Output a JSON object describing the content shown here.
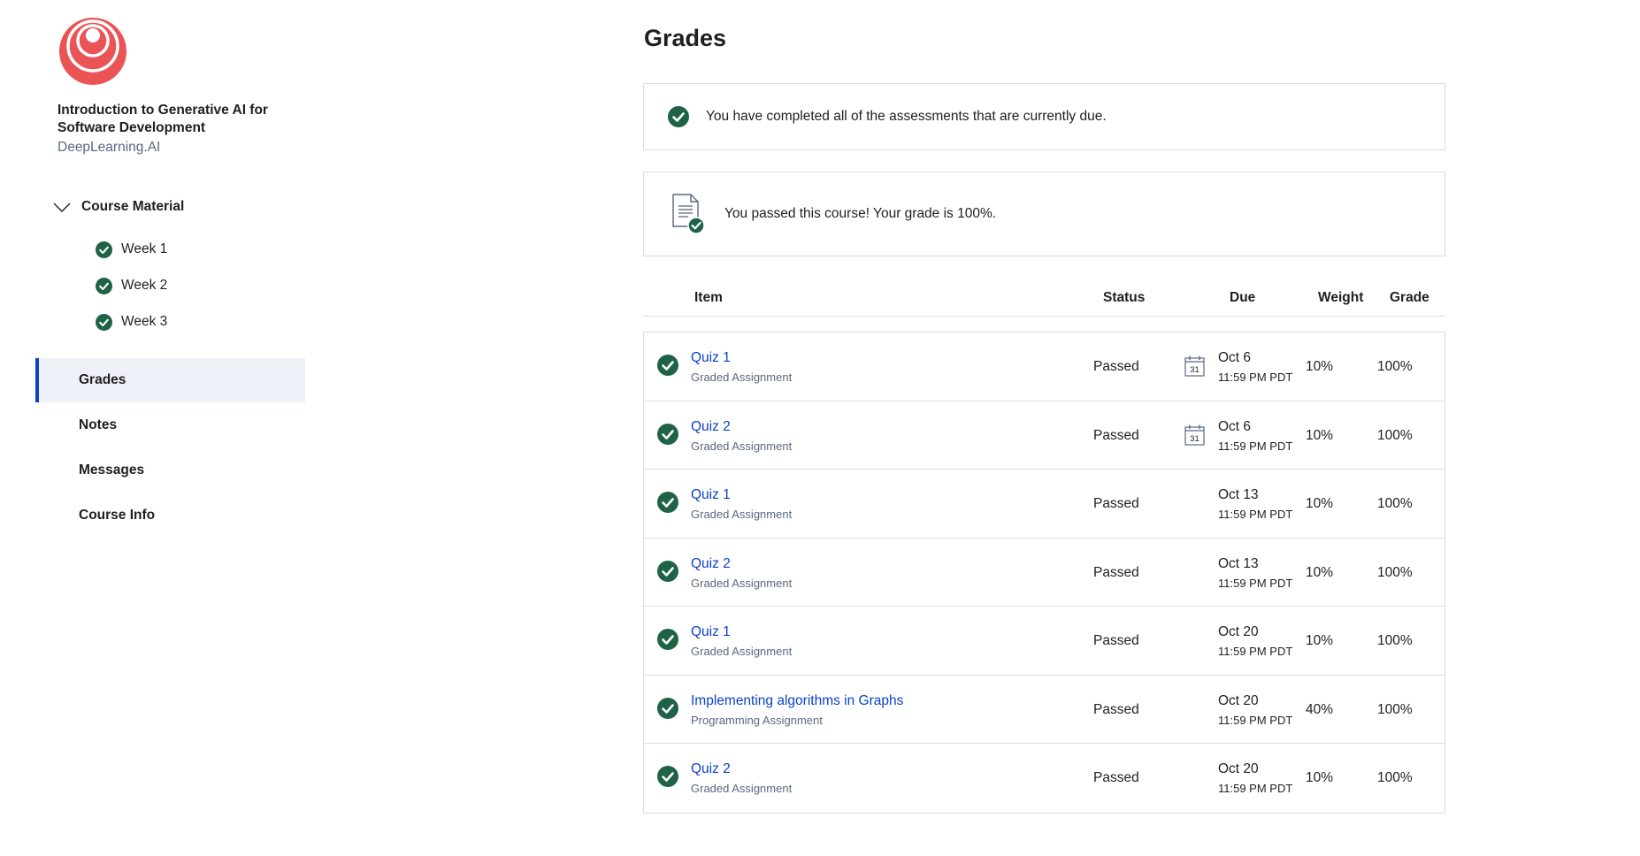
{
  "colors": {
    "accent": "#0b41c9",
    "success": "#1f6347",
    "logo": "#ea5455",
    "muted": "#5b6780",
    "border": "#dadde3"
  },
  "sidebar": {
    "course_title": "Introduction to Generative AI for Software Development",
    "org": "DeepLearning.AI",
    "material_label": "Course Material",
    "weeks": [
      {
        "label": "Week 1",
        "icon": "check-circle-icon"
      },
      {
        "label": "Week 2",
        "icon": "check-circle-icon"
      },
      {
        "label": "Week 3",
        "icon": "check-circle-icon"
      }
    ],
    "nav": [
      {
        "label": "Grades",
        "active": true
      },
      {
        "label": "Notes",
        "active": false
      },
      {
        "label": "Messages",
        "active": false
      },
      {
        "label": "Course Info",
        "active": false
      }
    ]
  },
  "main": {
    "title": "Grades",
    "banner_completed": "You have completed all of the assessments that are currently due.",
    "banner_passed": "You passed this course! Your grade is 100%.",
    "columns": {
      "item": "Item",
      "status": "Status",
      "due": "Due",
      "weight": "Weight",
      "grade": "Grade"
    },
    "rows": [
      {
        "name": "Quiz 1",
        "type": "Graded Assignment",
        "status": "Passed",
        "due_date": "Oct 6",
        "due_time": "11:59 PM PDT",
        "calendar_icon": true,
        "calendar_day": "31",
        "weight": "10%",
        "grade": "100%"
      },
      {
        "name": "Quiz 2",
        "type": "Graded Assignment",
        "status": "Passed",
        "due_date": "Oct 6",
        "due_time": "11:59 PM PDT",
        "calendar_icon": true,
        "calendar_day": "31",
        "weight": "10%",
        "grade": "100%"
      },
      {
        "name": "Quiz 1",
        "type": "Graded Assignment",
        "status": "Passed",
        "due_date": "Oct 13",
        "due_time": "11:59 PM PDT",
        "calendar_icon": false,
        "weight": "10%",
        "grade": "100%"
      },
      {
        "name": "Quiz 2",
        "type": "Graded Assignment",
        "status": "Passed",
        "due_date": "Oct 13",
        "due_time": "11:59 PM PDT",
        "calendar_icon": false,
        "weight": "10%",
        "grade": "100%"
      },
      {
        "name": "Quiz 1",
        "type": "Graded Assignment",
        "status": "Passed",
        "due_date": "Oct 20",
        "due_time": "11:59 PM PDT",
        "calendar_icon": false,
        "weight": "10%",
        "grade": "100%"
      },
      {
        "name": "Implementing algorithms in Graphs",
        "type": "Programming Assignment",
        "status": "Passed",
        "due_date": "Oct 20",
        "due_time": "11:59 PM PDT",
        "calendar_icon": false,
        "weight": "40%",
        "grade": "100%"
      },
      {
        "name": "Quiz 2",
        "type": "Graded Assignment",
        "status": "Passed",
        "due_date": "Oct 20",
        "due_time": "11:59 PM PDT",
        "calendar_icon": false,
        "weight": "10%",
        "grade": "100%"
      }
    ]
  }
}
